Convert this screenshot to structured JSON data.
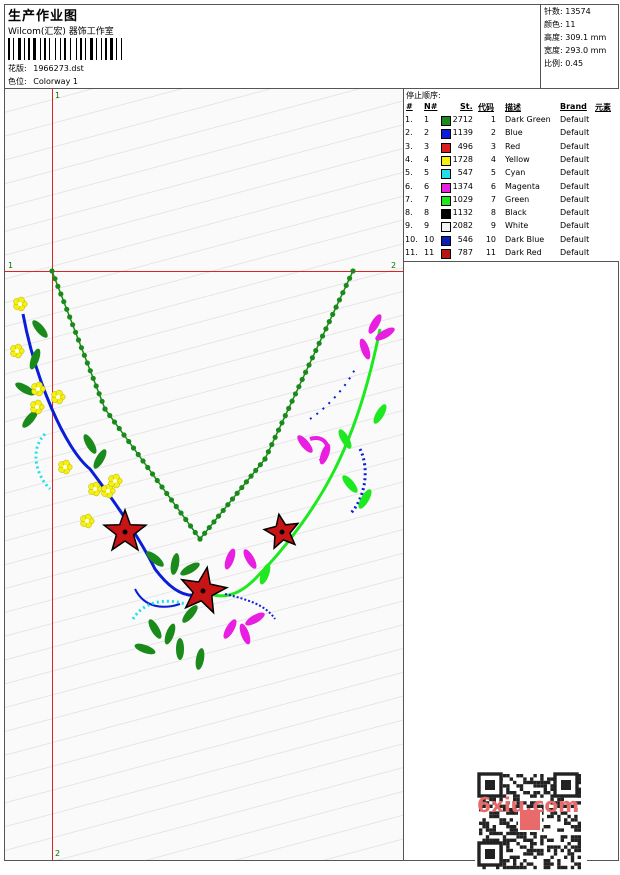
{
  "header": {
    "title": "生产作业图",
    "company": "Wilcom(汇宏) 器饰工作室",
    "design_label": "花版:",
    "design_value": "1966273.dst",
    "colorway_label": "色位:",
    "colorway_value": "Colorway 1"
  },
  "stats": {
    "stitches": "针数: 13574",
    "colors": "颜色: 11",
    "height": "高度: 309.1 mm",
    "width": "宽度: 293.0 mm",
    "scale": "比例: 0.45"
  },
  "stop_sequence": {
    "title": "停止顺序:",
    "columns": {
      "hash": "#",
      "n": "N#",
      "st": "St.",
      "code": "代码",
      "desc": "描述",
      "brand": "Brand",
      "elem": "元素"
    },
    "rows": [
      {
        "idx": "1.",
        "n": "1",
        "color": "#1a8a1a",
        "st": "2712",
        "code": "1",
        "desc": "Dark Green",
        "brand": "Default"
      },
      {
        "idx": "2.",
        "n": "2",
        "color": "#0a1ed8",
        "st": "1139",
        "code": "2",
        "desc": "Blue",
        "brand": "Default"
      },
      {
        "idx": "3.",
        "n": "3",
        "color": "#d81e1e",
        "st": "496",
        "code": "3",
        "desc": "Red",
        "brand": "Default"
      },
      {
        "idx": "4.",
        "n": "4",
        "color": "#f5f012",
        "st": "1728",
        "code": "4",
        "desc": "Yellow",
        "brand": "Default"
      },
      {
        "idx": "5.",
        "n": "5",
        "color": "#1ee0e8",
        "st": "547",
        "code": "5",
        "desc": "Cyan",
        "brand": "Default"
      },
      {
        "idx": "6.",
        "n": "6",
        "color": "#e81ee0",
        "st": "1374",
        "code": "6",
        "desc": "Magenta",
        "brand": "Default"
      },
      {
        "idx": "7.",
        "n": "7",
        "color": "#1ee81e",
        "st": "1029",
        "code": "7",
        "desc": "Green",
        "brand": "Default"
      },
      {
        "idx": "8.",
        "n": "8",
        "color": "#000000",
        "st": "1132",
        "code": "8",
        "desc": "Black",
        "brand": "Default"
      },
      {
        "idx": "9.",
        "n": "9",
        "color": "#f2f2f2",
        "st": "2082",
        "code": "9",
        "desc": "White",
        "brand": "Default"
      },
      {
        "idx": "10.",
        "n": "10",
        "color": "#0a1eb8",
        "st": "546",
        "code": "10",
        "desc": "Dark Blue",
        "brand": "Default"
      },
      {
        "idx": "11.",
        "n": "11",
        "color": "#b81414",
        "st": "787",
        "code": "11",
        "desc": "Dark Red",
        "brand": "Default"
      }
    ]
  },
  "guides": {
    "v_top": "1",
    "v_bottom": "2",
    "h_left": "1",
    "h_right": "2"
  },
  "watermark": "6xiu.com"
}
